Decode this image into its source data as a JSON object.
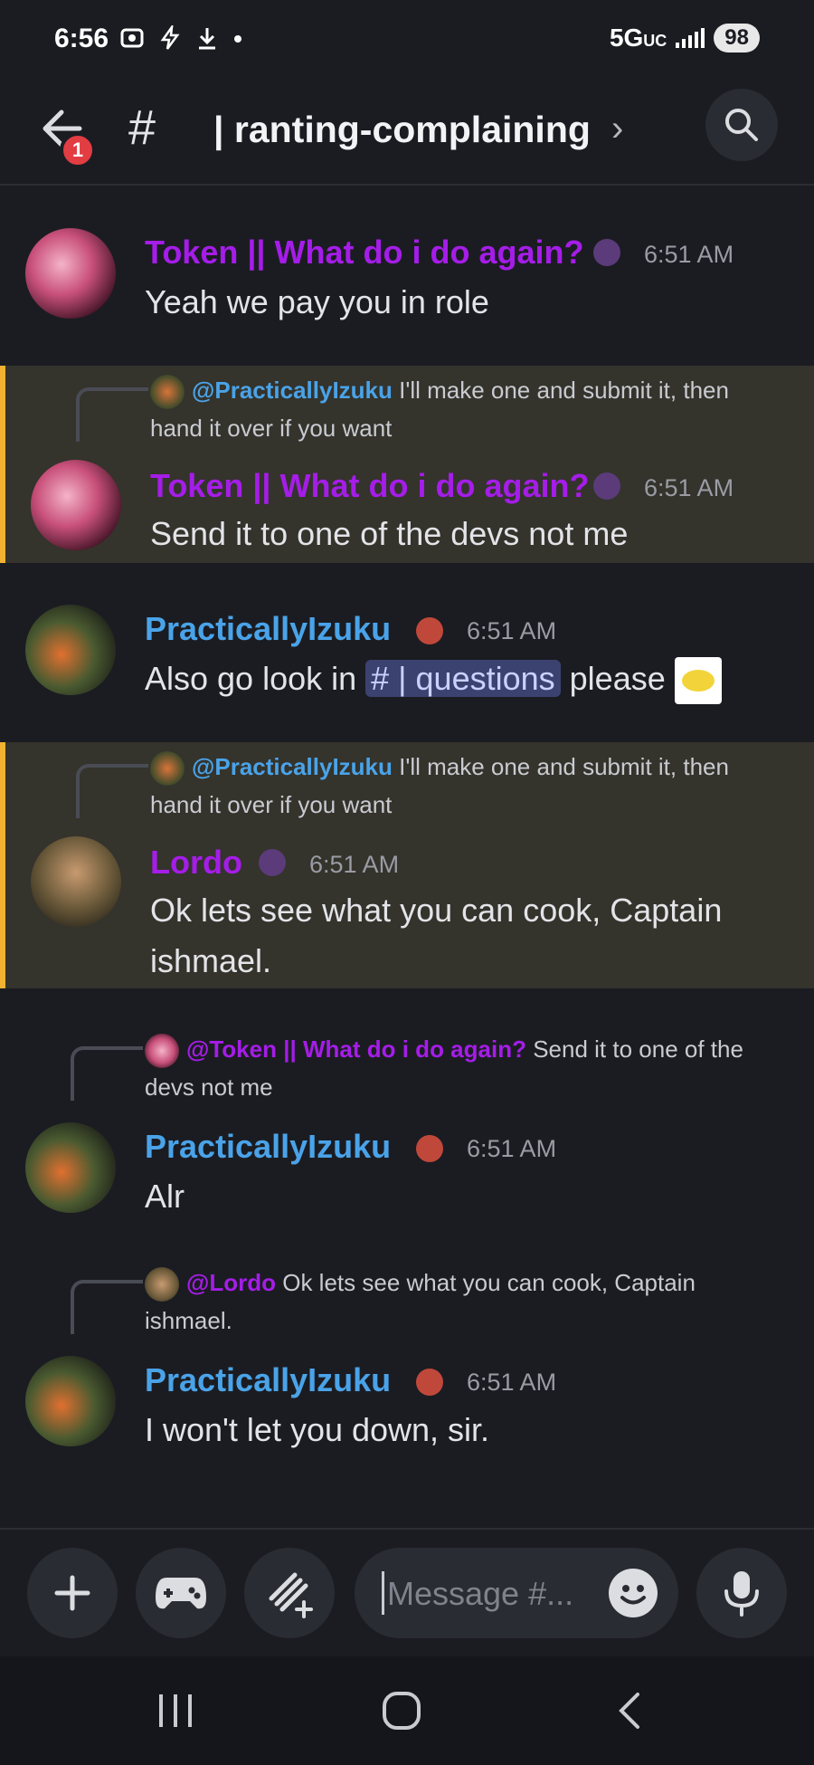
{
  "status_bar": {
    "time": "6:56",
    "network": "5G",
    "network_suffix": "UC",
    "battery": "98"
  },
  "header": {
    "notification_count": "1",
    "channel_hash": "#",
    "channel_name": "| ranting-complaining",
    "chevron": "›"
  },
  "messages": [
    {
      "author": "Token || What do i do again?",
      "author_color": "#a51de8",
      "time": "6:51 AM",
      "text": "Yeah we pay you in role"
    },
    {
      "reply_to": "@PracticallyIzuku",
      "reply_text": "I'll make one and submit it, then hand it over if you want",
      "author": "Token || What do i do again?",
      "time": "6:51 AM",
      "text": "Send it to one of the devs not me"
    },
    {
      "author": "PracticallyIzuku",
      "author_color": "#4aa3e8",
      "time": "6:51 AM",
      "text_before": "Also go look in",
      "channel_mention": "# | questions",
      "text_after": "please"
    },
    {
      "reply_to": "@PracticallyIzuku",
      "reply_text": "I'll make one and submit it, then hand it over if you want",
      "author": "Lordo",
      "time": "6:51 AM",
      "text": "Ok lets see what you can cook, Captain ishmael."
    },
    {
      "reply_to": "@Token || What do i do again?",
      "reply_text": "Send it to one of the devs not me",
      "author": "PracticallyIzuku",
      "time": "6:51 AM",
      "text": "Alr"
    },
    {
      "reply_to": "@Lordo",
      "reply_text": "Ok lets see what you can cook, Captain ishmael.",
      "author": "PracticallyIzuku",
      "time": "6:51 AM",
      "text": "I won't let you down, sir."
    }
  ],
  "composer": {
    "placeholder": "Message #..."
  },
  "colors": {
    "background": "#1b1c22",
    "highlight": "#34332c",
    "highlight_bar": "#f0b232",
    "blue_name": "#4aa3e8",
    "purple_name": "#a51de8"
  },
  "icons": [
    "back-arrow-icon",
    "search-icon",
    "plus-icon",
    "gamepad-icon",
    "apps-sparkle-icon",
    "emoji-icon",
    "microphone-icon"
  ]
}
